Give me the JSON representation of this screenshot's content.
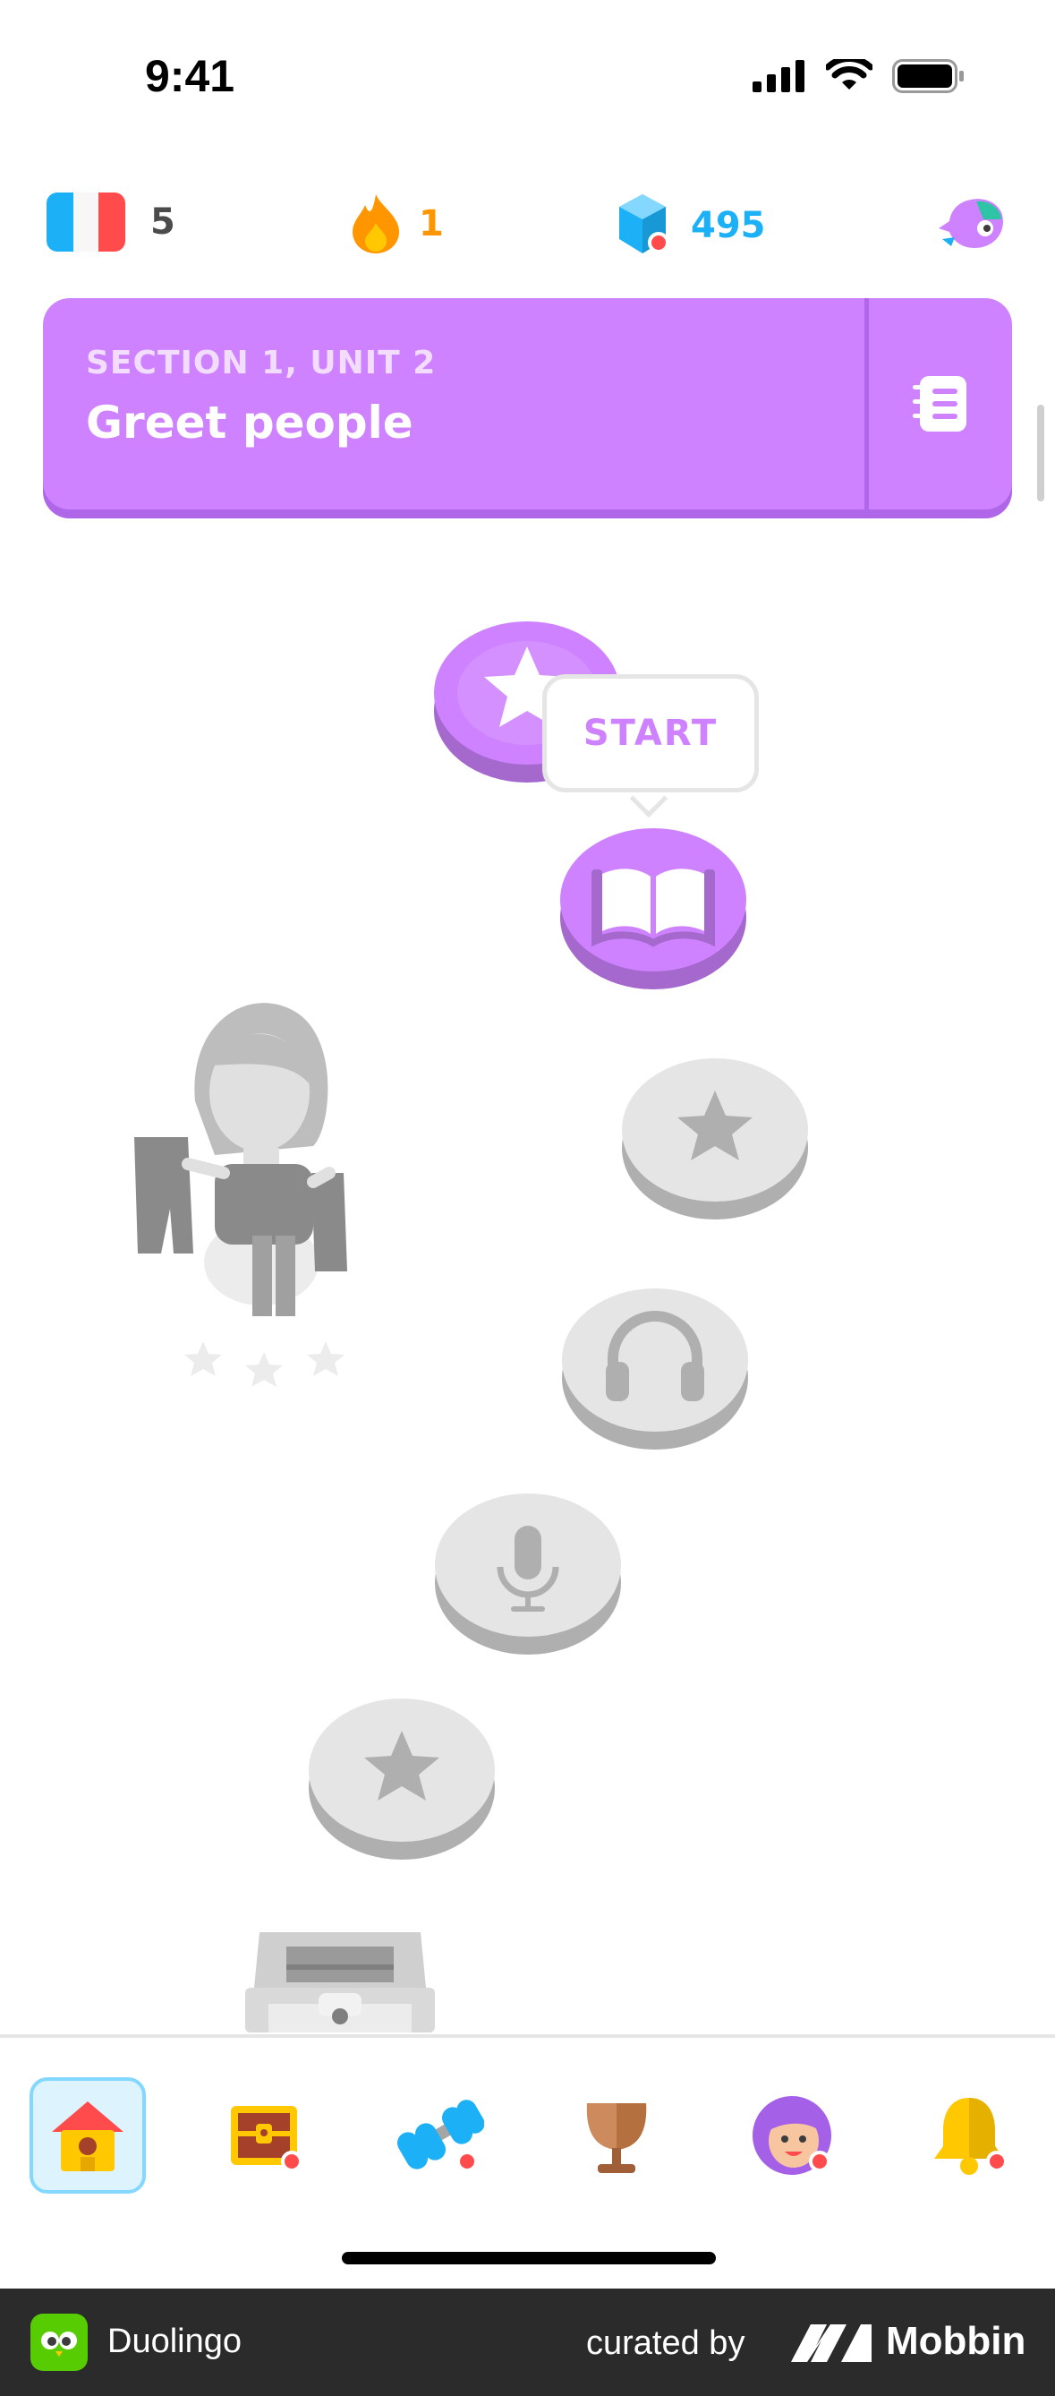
{
  "status_bar": {
    "time": "9:41"
  },
  "stats": {
    "streak_flag_count": "5",
    "streak_days": "1",
    "gems": "495"
  },
  "unit": {
    "section": "SECTION 1, UNIT 2",
    "title": "Greet people"
  },
  "path": {
    "start_label": "START"
  },
  "colors": {
    "accent_purple": "#ce82ff",
    "locked_gray": "#e5e5e5",
    "streak_orange": "#ff9600",
    "gems_blue": "#1cb0f6"
  },
  "tabs": [
    {
      "icon": "home-icon",
      "active": true
    },
    {
      "icon": "treasure-chest-icon",
      "badge": true
    },
    {
      "icon": "dumbbell-icon",
      "badge": true
    },
    {
      "icon": "trophy-icon"
    },
    {
      "icon": "profile-avatar-icon",
      "badge": true
    },
    {
      "icon": "bell-icon",
      "badge": true
    }
  ],
  "footer": {
    "app_name": "Duolingo",
    "curated_by": "curated by",
    "brand": "Mobbin"
  }
}
